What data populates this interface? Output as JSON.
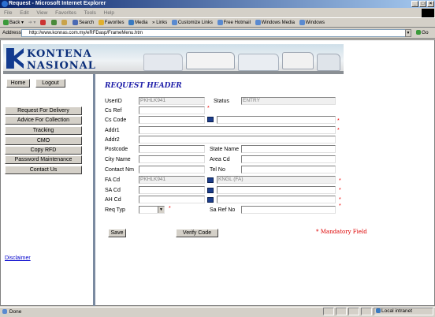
{
  "window": {
    "title": "Request - Microsoft Internet Explorer"
  },
  "menu": [
    "File",
    "Edit",
    "View",
    "Favorites",
    "Tools",
    "Help"
  ],
  "toolbar": {
    "back": "Back",
    "search": "Search",
    "favorites": "Favorites",
    "media": "Media",
    "links": "Links",
    "customize": "Customize Links",
    "hotmail": "Free Hotmail",
    "winmedia": "Windows Media",
    "windows": "Windows"
  },
  "address": {
    "label": "Address",
    "url": "http://www.konnas.com.my/eRFDasp/FrameMenu.htm",
    "go": "Go"
  },
  "brand": {
    "line1": "KONTENA",
    "line2": "NASIONAL"
  },
  "nav": {
    "home": "Home",
    "logout": "Logout",
    "items": [
      "Request For Delivery",
      "Advice For Collection",
      "Tracking",
      "CMO",
      "Copy RFD",
      "Password Maintenance",
      "Contact Us"
    ],
    "disclaimer": "Disclaimer"
  },
  "form": {
    "title": "REQUEST HEADER",
    "labels": {
      "userid": "UserID",
      "status": "Status",
      "csref": "Cs Ref",
      "cscode": "Cs Code",
      "addr1": "Addr1",
      "addr2": "Addr2",
      "postcode": "Postcode",
      "statename": "State Name",
      "cityname": "City Name",
      "areacd": "Area Cd",
      "contactnm": "Contact Nm",
      "telno": "Tel No",
      "facd": "FA Cd",
      "sacd": "SA Cd",
      "ahcd": "AH Cd",
      "reqtyp": "Req Typ",
      "sarefno": "Sa Ref No"
    },
    "values": {
      "userid": "PKHLK941",
      "status": "ENTRY",
      "facd": "PKHLK941",
      "fa_name": "KNGL (FA)"
    },
    "asterisk": "*",
    "save": "Save",
    "verify": "Verify Code",
    "mandatory": "* Mandatory Field"
  },
  "statusbar": {
    "done": "Done",
    "zone": "Local intranet"
  }
}
